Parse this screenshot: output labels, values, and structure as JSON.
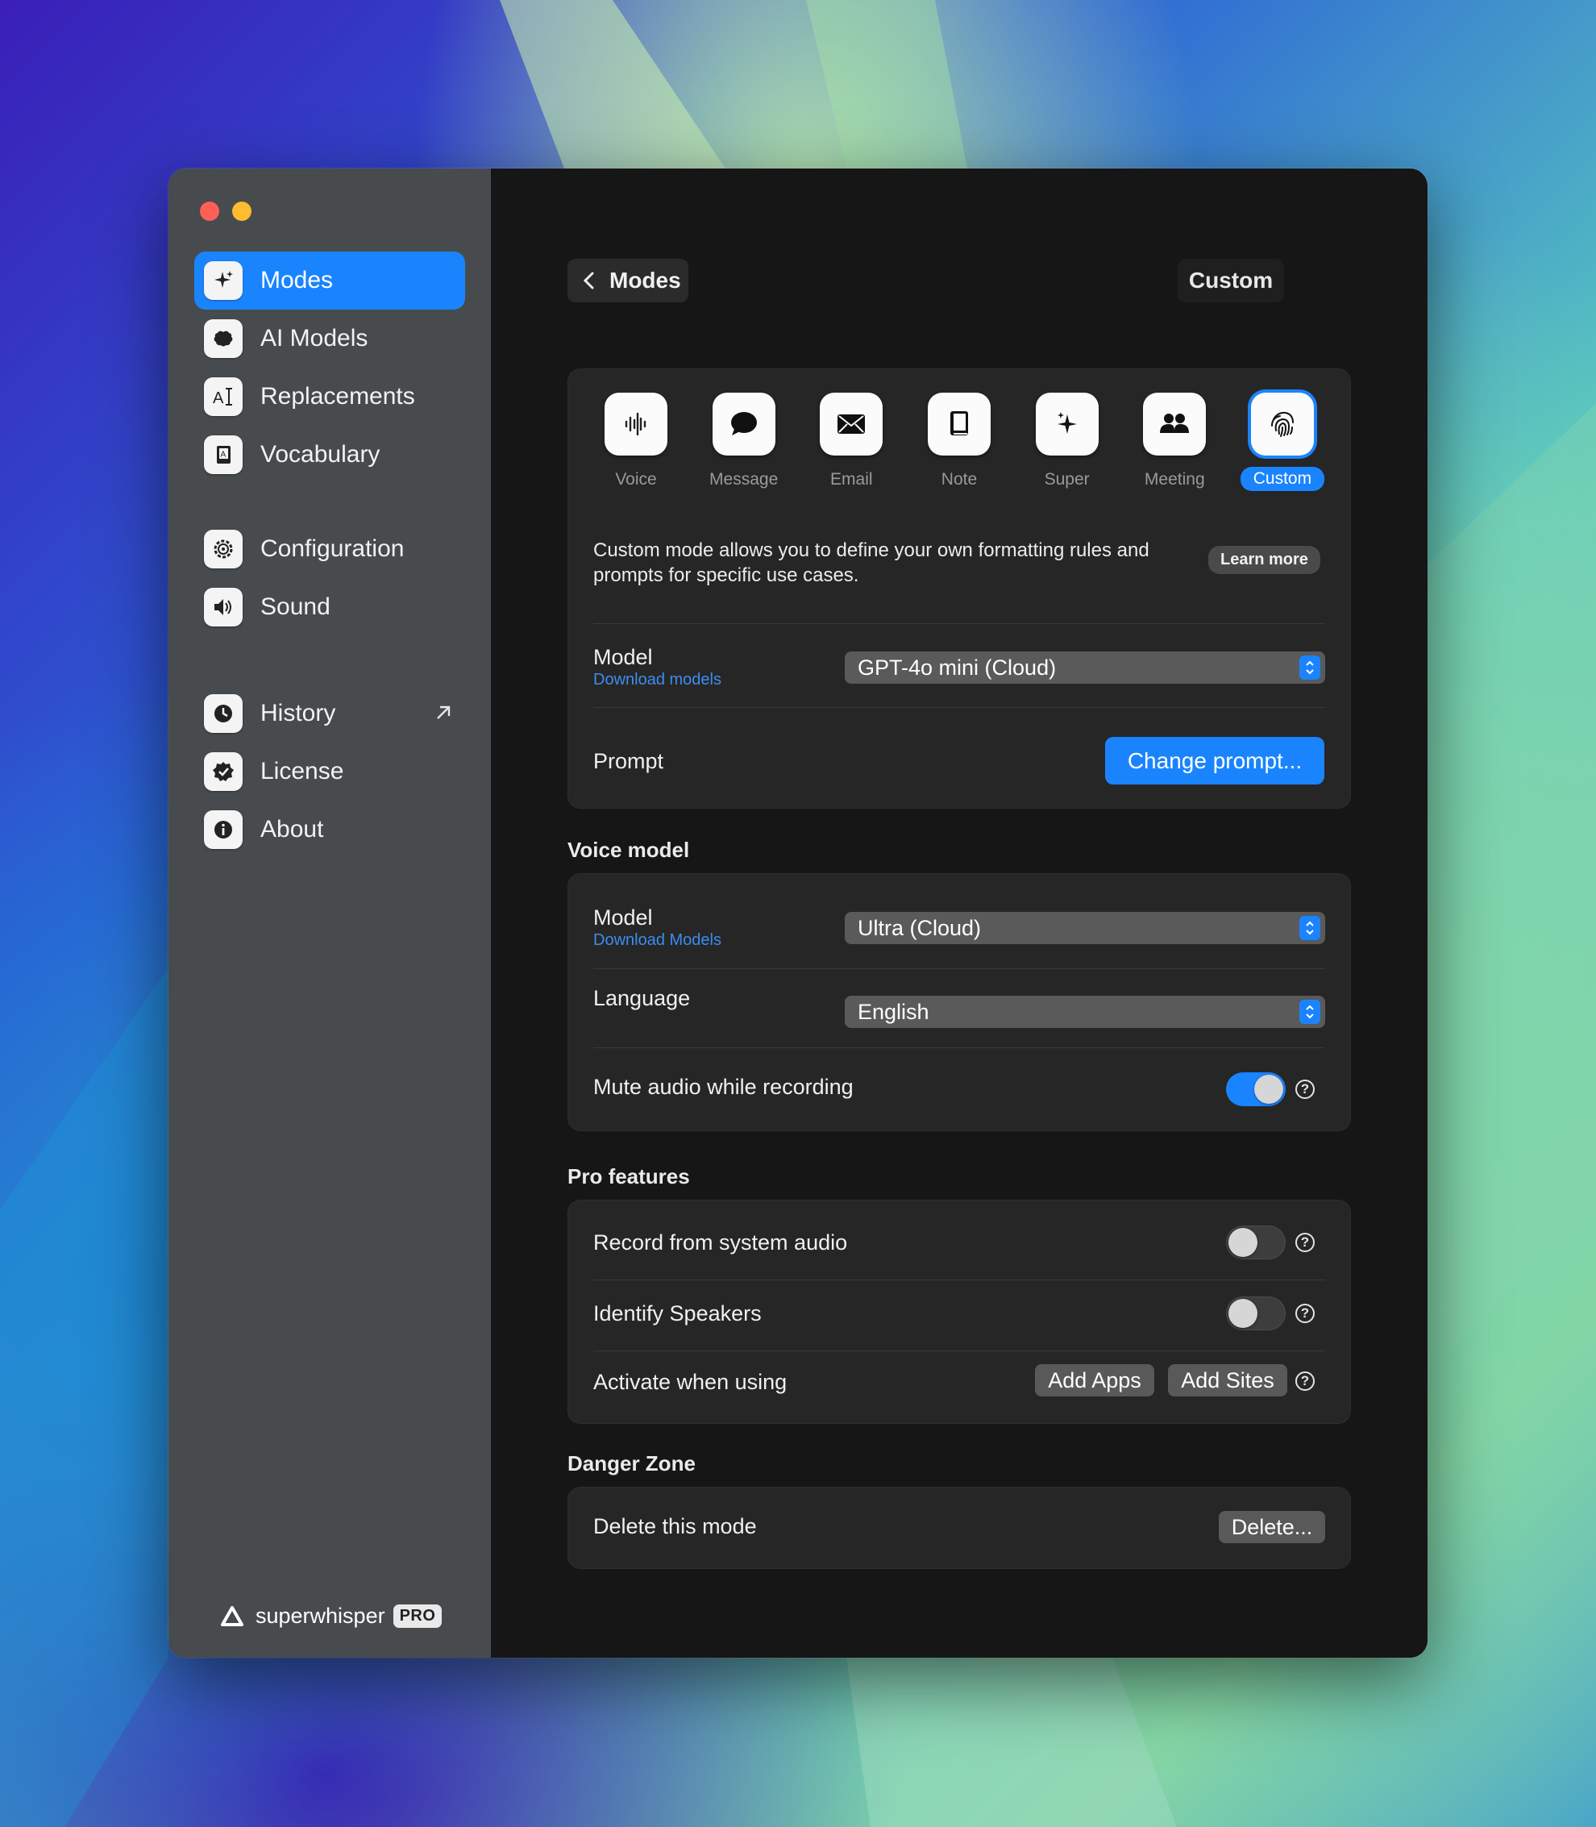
{
  "sidebar": {
    "items": [
      {
        "label": "Modes",
        "icon": "sparkles-icon"
      },
      {
        "label": "AI Models",
        "icon": "brain-icon"
      },
      {
        "label": "Replacements",
        "icon": "text-cursor-icon"
      },
      {
        "label": "Vocabulary",
        "icon": "book-icon"
      },
      {
        "label": "Configuration",
        "icon": "gear-icon"
      },
      {
        "label": "Sound",
        "icon": "speaker-icon"
      },
      {
        "label": "History",
        "icon": "clock-icon"
      },
      {
        "label": "License",
        "icon": "seal-check-icon"
      },
      {
        "label": "About",
        "icon": "info-icon"
      }
    ],
    "brand_name": "superwhisper",
    "brand_badge": "PRO"
  },
  "header": {
    "back_label": "Modes",
    "title": "Custom"
  },
  "modes": [
    {
      "label": "Voice",
      "icon": "waveform-icon"
    },
    {
      "label": "Message",
      "icon": "speech-bubble-icon"
    },
    {
      "label": "Email",
      "icon": "envelope-icon"
    },
    {
      "label": "Note",
      "icon": "notebook-icon"
    },
    {
      "label": "Super",
      "icon": "sparkles-icon"
    },
    {
      "label": "Meeting",
      "icon": "people-icon"
    },
    {
      "label": "Custom",
      "icon": "fingerprint-icon"
    }
  ],
  "mode_card": {
    "description": "Custom mode allows you to define your own formatting rules and prompts for specific use cases.",
    "learn_more": "Learn more",
    "model_label": "Model",
    "model_link": "Download models",
    "model_value": "GPT-4o mini (Cloud)",
    "prompt_label": "Prompt",
    "prompt_button": "Change prompt..."
  },
  "voice_model": {
    "heading": "Voice model",
    "model_label": "Model",
    "model_link": "Download Models",
    "model_value": "Ultra (Cloud)",
    "language_label": "Language",
    "language_value": "English",
    "mute_label": "Mute audio while recording",
    "mute_on": true
  },
  "pro_features": {
    "heading": "Pro features",
    "system_audio_label": "Record from system audio",
    "system_audio_on": false,
    "speakers_label": "Identify Speakers",
    "speakers_on": false,
    "activate_label": "Activate when using",
    "add_apps": "Add Apps",
    "add_sites": "Add Sites"
  },
  "danger": {
    "heading": "Danger Zone",
    "delete_label": "Delete this mode",
    "delete_button": "Delete..."
  },
  "colors": {
    "accent": "#1a84ff",
    "sidebar_bg": "#474b4d",
    "content_bg": "#161616",
    "card_bg": "#262626"
  }
}
